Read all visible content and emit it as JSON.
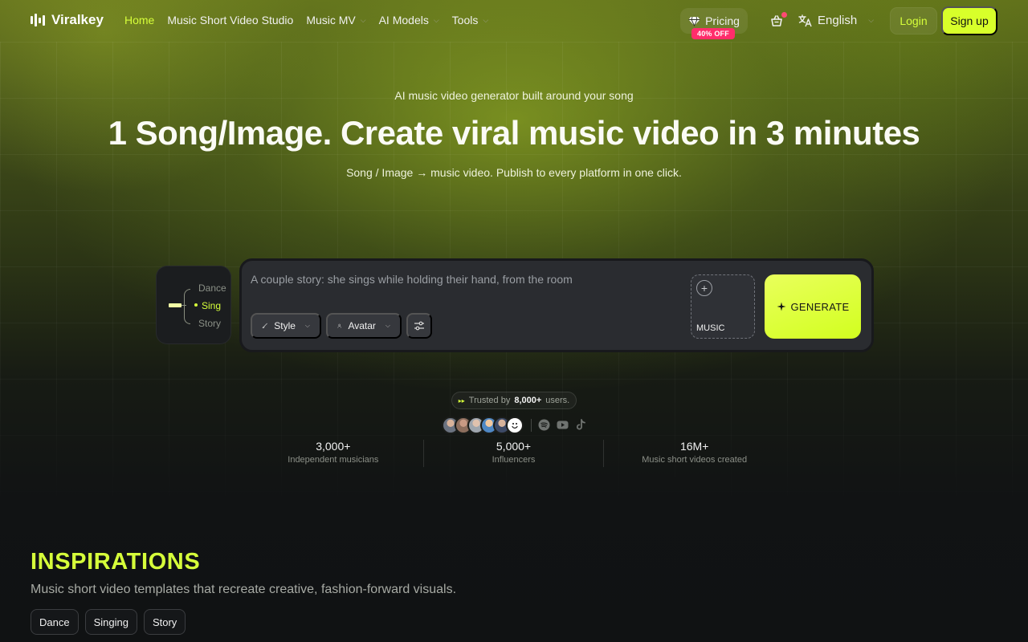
{
  "brand": {
    "name": "Viralkey"
  },
  "nav": {
    "items": [
      {
        "label": "Home",
        "active": true,
        "dropdown": false
      },
      {
        "label": "Music Short Video Studio",
        "active": false,
        "dropdown": false
      },
      {
        "label": "Music MV",
        "active": false,
        "dropdown": true
      },
      {
        "label": "AI Models",
        "active": false,
        "dropdown": true
      },
      {
        "label": "Tools",
        "active": false,
        "dropdown": true
      }
    ],
    "pricing_label": "Pricing",
    "pricing_badge": "40% OFF",
    "language": "English",
    "login_label": "Login",
    "signup_label": "Sign up"
  },
  "hero": {
    "eyebrow": "AI music video generator built around your song",
    "headline": "1 Song/Image. Create viral music video in 3 minutes",
    "subline": "Song / Image → music video. Publish to every platform in one click."
  },
  "modes": {
    "items": [
      "Dance",
      "Sing",
      "Story"
    ],
    "selected": "Sing"
  },
  "composer": {
    "placeholder": "A couple story: she sings while holding their hand, from the room",
    "style_label": "Style",
    "avatar_label": "Avatar",
    "music_label": "MUSIC",
    "generate_label": "GENERATE"
  },
  "trust": {
    "prefix": "Trusted by",
    "count": "8,000+",
    "suffix": "users.",
    "platform_icons": [
      "spotify-icon",
      "youtube-icon",
      "tiktok-icon"
    ]
  },
  "stats": [
    {
      "value": "3,000+",
      "label": "Independent musicians"
    },
    {
      "value": "5,000+",
      "label": "Influencers"
    },
    {
      "value": "16M+",
      "label": "Music short videos created"
    }
  ],
  "inspirations": {
    "title": "INSPIRATIONS",
    "subtitle": "Music short video templates that recreate creative, fashion-forward visuals.",
    "filters": [
      "Dance",
      "Singing",
      "Story"
    ]
  },
  "colors": {
    "accent": "#d6ff3a",
    "badge": "#ff2d6b",
    "background": "#0f1112"
  }
}
